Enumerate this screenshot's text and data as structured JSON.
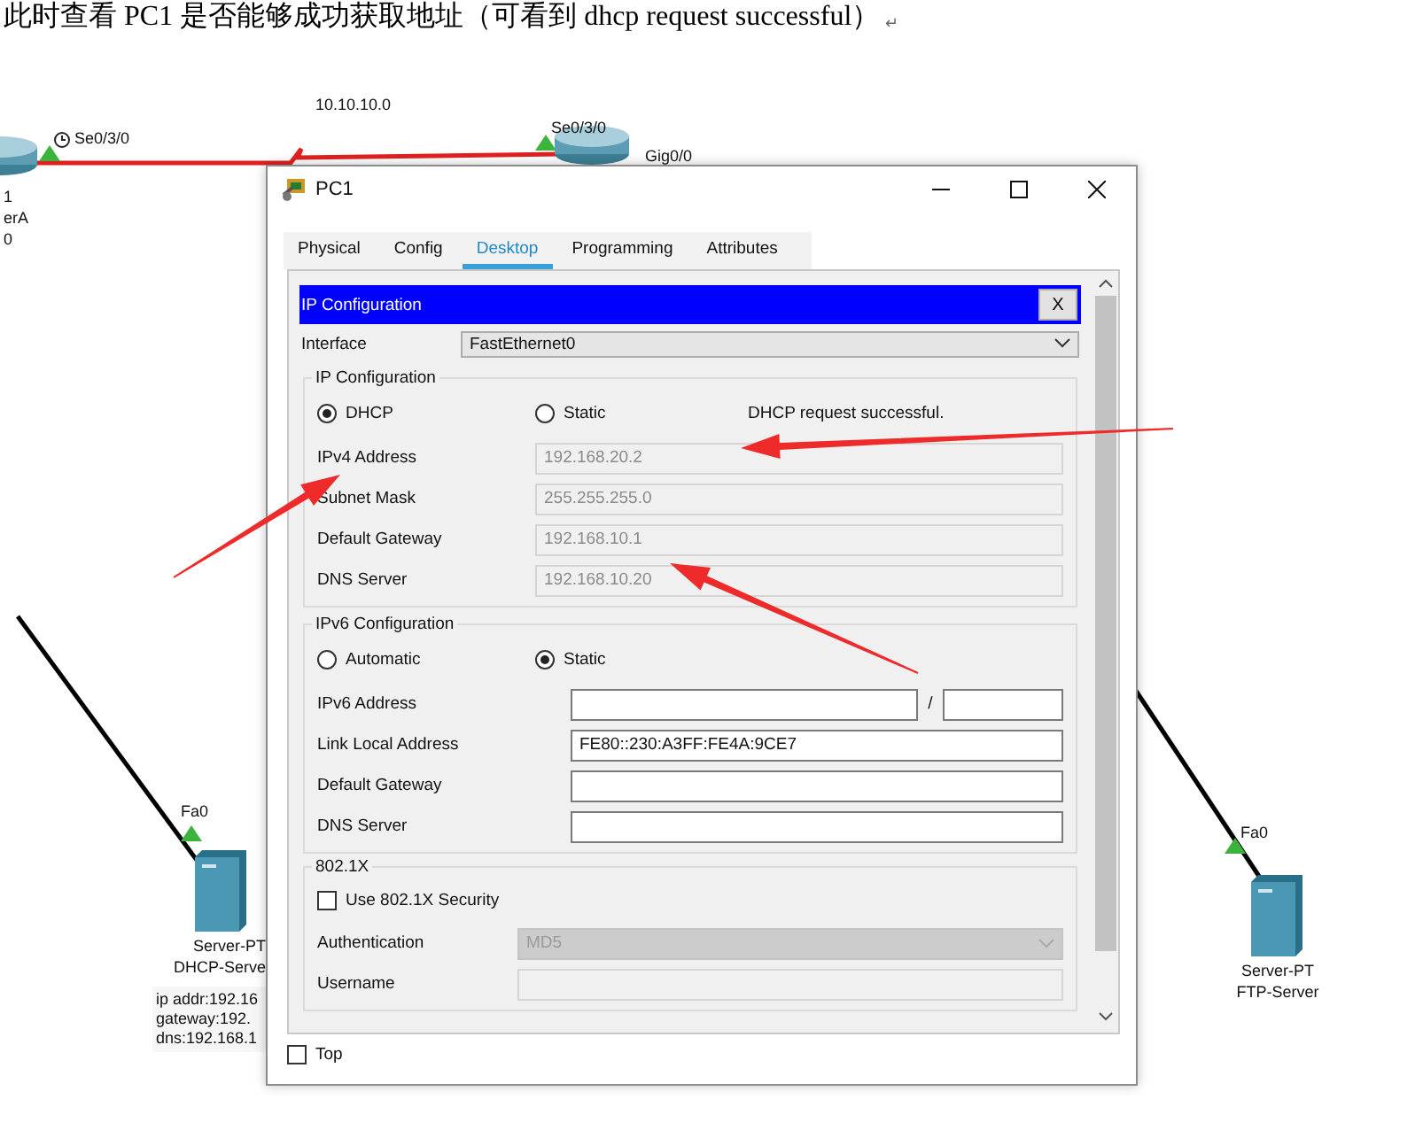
{
  "caption": {
    "text": "此时查看 PC1 是否能够成功获取地址（可看到 dhcp request successful）",
    "mark": "↵"
  },
  "topology": {
    "link_labels": [
      "Se0/3/0",
      "10.10.10.0",
      "Se0/3/0",
      "Gig0/0",
      "Fa0",
      "Fa0"
    ],
    "devices": [
      {
        "kind": "router",
        "lines": [
          "1",
          "erA",
          "0"
        ]
      },
      {
        "kind": "router"
      },
      {
        "kind": "server",
        "lines": [
          "Server-PT",
          "DHCP-Serve"
        ],
        "note": [
          "ip addr:192.16",
          "gateway:192.",
          "dns:192.168.1"
        ]
      },
      {
        "kind": "server",
        "lines": [
          "Server-PT",
          "FTP-Server"
        ]
      }
    ]
  },
  "window": {
    "title": "PC1",
    "tabs": [
      {
        "label": "Physical",
        "selected": false
      },
      {
        "label": "Config",
        "selected": false
      },
      {
        "label": "Desktop",
        "selected": true
      },
      {
        "label": "Programming",
        "selected": false
      },
      {
        "label": "Attributes",
        "selected": false
      }
    ],
    "panel": {
      "title": "IP Configuration",
      "close": "X",
      "interface_label": "Interface",
      "interface": "FastEthernet0",
      "ipv4": {
        "legend": "IP Configuration",
        "status": "DHCP request successful.",
        "modes": [
          {
            "label": "DHCP",
            "selected": true
          },
          {
            "label": "Static",
            "selected": false
          }
        ],
        "fields": [
          {
            "label": "IPv4 Address",
            "value": "192.168.20.2",
            "disabled": true
          },
          {
            "label": "Subnet Mask",
            "value": "255.255.255.0",
            "disabled": true
          },
          {
            "label": "Default Gateway",
            "value": "192.168.10.1",
            "disabled": true
          },
          {
            "label": "DNS Server",
            "value": "192.168.10.20",
            "disabled": true
          }
        ]
      },
      "ipv6": {
        "legend": "IPv6 Configuration",
        "modes": [
          {
            "label": "Automatic",
            "selected": false
          },
          {
            "label": "Static",
            "selected": true
          }
        ],
        "fields": [
          {
            "label": "IPv6 Address",
            "kind": "prefix",
            "separator": "/",
            "disabled": false
          },
          {
            "label": "Link Local Address",
            "kind": "text",
            "value": "FE80::230:A3FF:FE4A:9CE7",
            "disabled": false
          },
          {
            "label": "Default Gateway",
            "kind": "text",
            "disabled": false
          },
          {
            "label": "DNS Server",
            "kind": "text",
            "disabled": false
          }
        ]
      },
      "dot1x": {
        "legend": "802.1X",
        "checkbox": {
          "label": "Use 802.1X Security",
          "checked": false
        },
        "fields": [
          {
            "label": "Authentication",
            "kind": "dropdown",
            "value": "MD5",
            "disabled": true
          },
          {
            "label": "Username",
            "kind": "text",
            "disabled": true
          }
        ]
      }
    },
    "top": {
      "label": "Top",
      "checked": false
    }
  }
}
